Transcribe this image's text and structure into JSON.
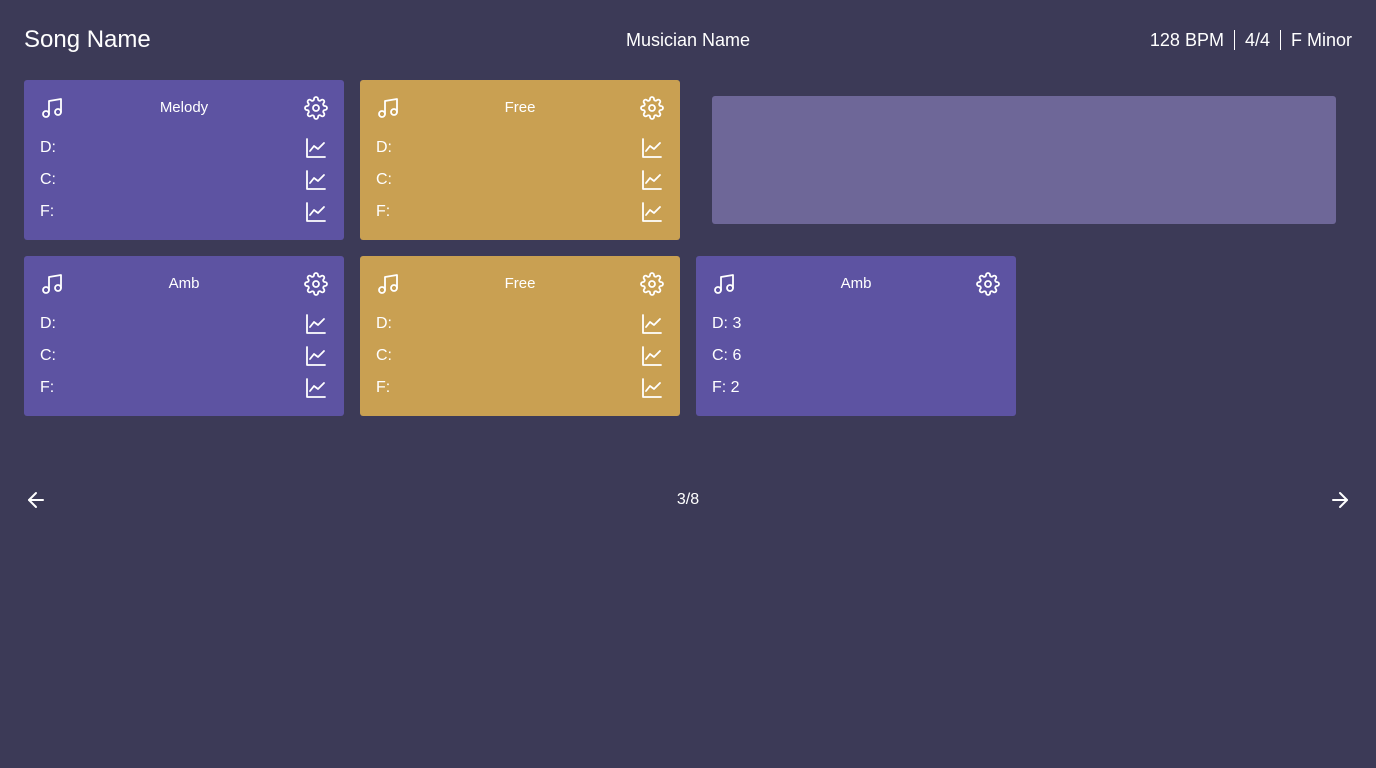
{
  "header": {
    "song_name": "Song Name",
    "musician_name": "Musician Name",
    "bpm": "128 BPM",
    "time_signature": "4/4",
    "key": "F Minor"
  },
  "icons": {
    "instrument": "music-note-icon",
    "settings": "gear-icon",
    "param": "line-chart-icon",
    "prev": "arrow-left-icon",
    "next": "arrow-right-icon"
  },
  "colors": {
    "background": "#3c3a57",
    "card_purple": "#5d53a2",
    "card_gold": "#c9a052",
    "card_empty": "#6e6798"
  },
  "cards": [
    {
      "title": "Melody",
      "color": "purple",
      "params": [
        "D:",
        "C:",
        "F:"
      ]
    },
    {
      "title": "Free",
      "color": "gold",
      "params": [
        "D:",
        "C:",
        "F:"
      ]
    },
    {
      "title": "Amb",
      "color": "purple",
      "params": [
        "D:",
        "C:",
        "F:"
      ]
    },
    {
      "title": "Free",
      "color": "gold",
      "params": [
        "D:",
        "C:",
        "F:"
      ]
    },
    {
      "title": "Amb",
      "color": "purple",
      "params": [
        "D: 3",
        "C: 6",
        "F: 2"
      ]
    }
  ],
  "pagination": {
    "indicator": "3/8"
  }
}
